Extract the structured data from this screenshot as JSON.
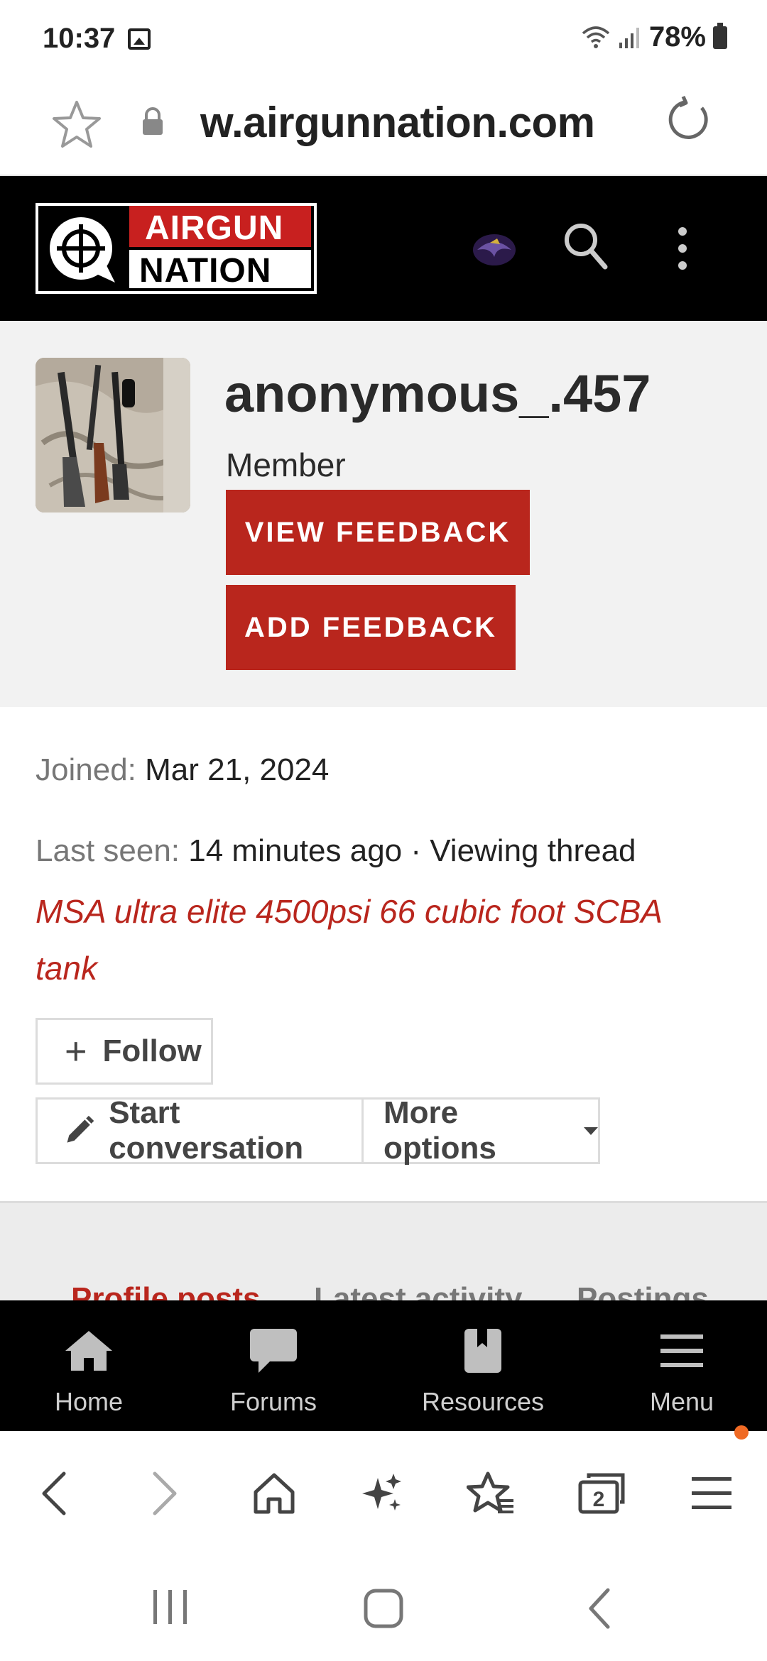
{
  "status_bar": {
    "time": "10:37",
    "battery": "78%"
  },
  "url_bar": {
    "url": "w.airgunnation.com"
  },
  "site_header": {
    "logo_line1": "AIRGUN",
    "logo_line2": "NATION"
  },
  "profile": {
    "username": "anonymous_.457",
    "title": "Member",
    "view_feedback_label": "VIEW FEEDBACK",
    "add_feedback_label": "ADD FEEDBACK"
  },
  "info": {
    "joined_label": "Joined:",
    "joined_value": "Mar 21, 2024",
    "last_seen_label": "Last seen:",
    "last_seen_value": "14 minutes ago · Viewing thread",
    "thread_title": "MSA ultra elite 4500psi 66 cubic foot SCBA tank",
    "follow_label": "Follow",
    "start_conversation_label": "Start conversation",
    "more_options_label": "More options"
  },
  "tabs": [
    {
      "label": "Profile posts"
    },
    {
      "label": "Latest activity"
    },
    {
      "label": "Postings"
    }
  ],
  "site_nav": {
    "items": [
      {
        "label": "Home"
      },
      {
        "label": "Forums"
      },
      {
        "label": "Resources"
      },
      {
        "label": "Menu"
      }
    ]
  },
  "browser_toolbar": {
    "tab_count": "2"
  },
  "colors": {
    "brand_red": "#b9261d",
    "header_black": "#000000",
    "profile_bg": "#f2f2f2"
  }
}
